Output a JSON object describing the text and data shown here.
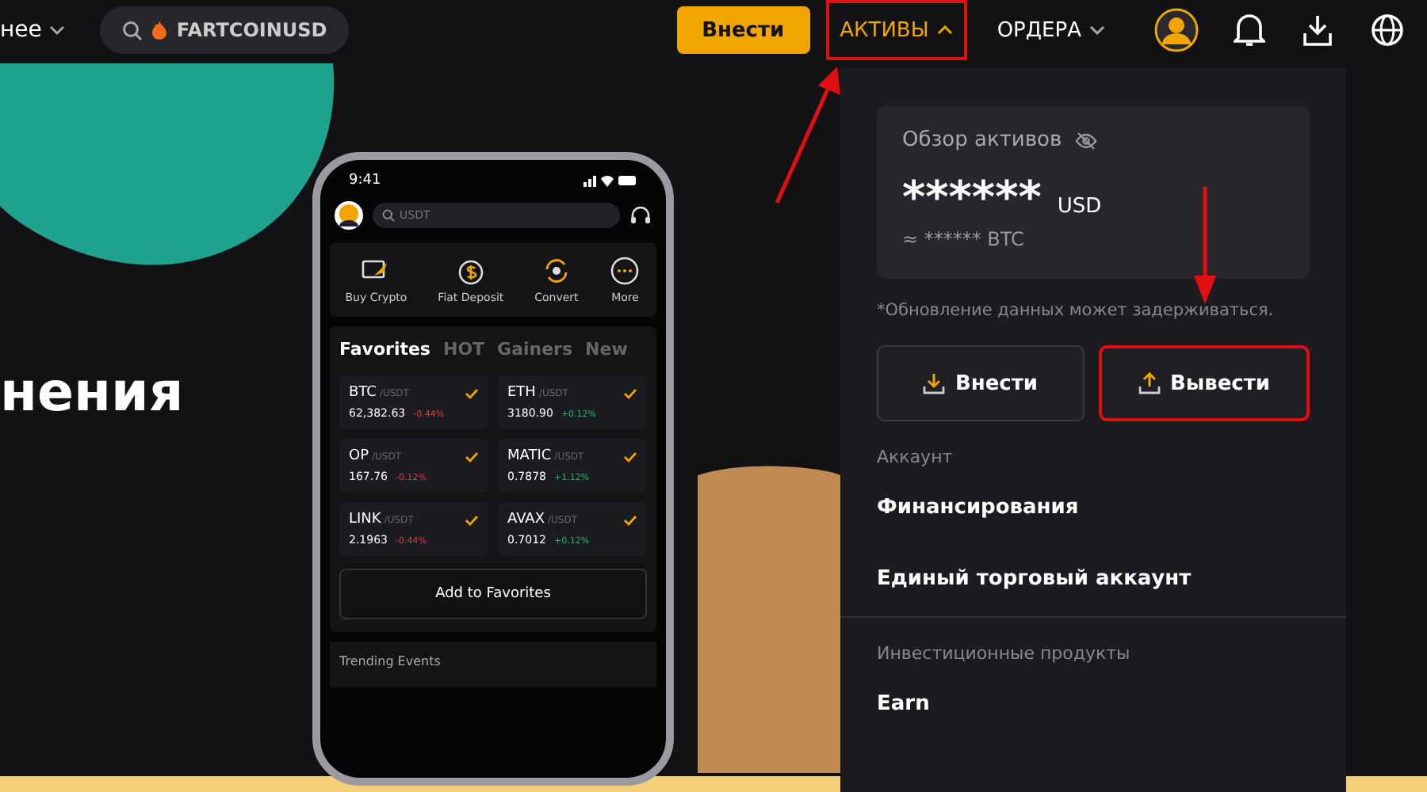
{
  "topbar": {
    "menu_partial": "нее",
    "search": {
      "value": "FARTCOINUSD"
    },
    "deposit_button": "Внести",
    "nav": [
      {
        "label": "АКТИВЫ",
        "selected": true,
        "highlighted": true
      },
      {
        "label": "ОРДЕРА",
        "selected": false,
        "highlighted": false
      }
    ]
  },
  "hero": {
    "heading_partial": "нения"
  },
  "phone": {
    "time": "9:41",
    "search_placeholder": "USDT",
    "actions": [
      {
        "kind": "buy",
        "label": "Buy Crypto"
      },
      {
        "kind": "fiat",
        "label": "Fiat Deposit"
      },
      {
        "kind": "convert",
        "label": "Convert"
      },
      {
        "kind": "more",
        "label": "More"
      }
    ],
    "tabs": [
      {
        "label": "Favorites",
        "selected": true
      },
      {
        "label": "HOT",
        "selected": false
      },
      {
        "label": "Gainers",
        "selected": false
      },
      {
        "label": "New",
        "selected": false
      }
    ],
    "pairs": [
      {
        "base": "BTC",
        "quote": "/USDT",
        "price": "62,382.63",
        "change": "-0.44%",
        "up": false,
        "checked": true
      },
      {
        "base": "ETH",
        "quote": "/USDT",
        "price": "3180.90",
        "change": "+0.12%",
        "up": true,
        "checked": true
      },
      {
        "base": "OP",
        "quote": "/USDT",
        "price": "167.76",
        "change": "-0.12%",
        "up": false,
        "checked": true
      },
      {
        "base": "MATIC",
        "quote": "/USDT",
        "price": "0.7878",
        "change": "+1.12%",
        "up": true,
        "checked": true
      },
      {
        "base": "LINK",
        "quote": "/USDT",
        "price": "2.1963",
        "change": "-0.44%",
        "up": false,
        "checked": true
      },
      {
        "base": "AVAX",
        "quote": "/USDT",
        "price": "0.7012",
        "change": "+0.12%",
        "up": true,
        "checked": true
      }
    ],
    "add_button": "Add to Favorites",
    "trending": "Trending Events"
  },
  "assets_menu": {
    "overview_title": "Обзор активов",
    "balance": "******",
    "currency": "USD",
    "approx": "≈ ****** BTC",
    "note": "*Обновление данных может задерживаться.",
    "buttons": [
      {
        "kind": "deposit",
        "label": "Внести",
        "highlighted": false
      },
      {
        "kind": "withdraw",
        "label": "Вывести",
        "highlighted": true
      }
    ],
    "sections": [
      {
        "title": "Аккаунт",
        "items": [
          "Финансирования",
          "Единый торговый аккаунт"
        ]
      },
      {
        "title": "Инвестиционные продукты",
        "items": [
          "Earn"
        ]
      }
    ]
  }
}
